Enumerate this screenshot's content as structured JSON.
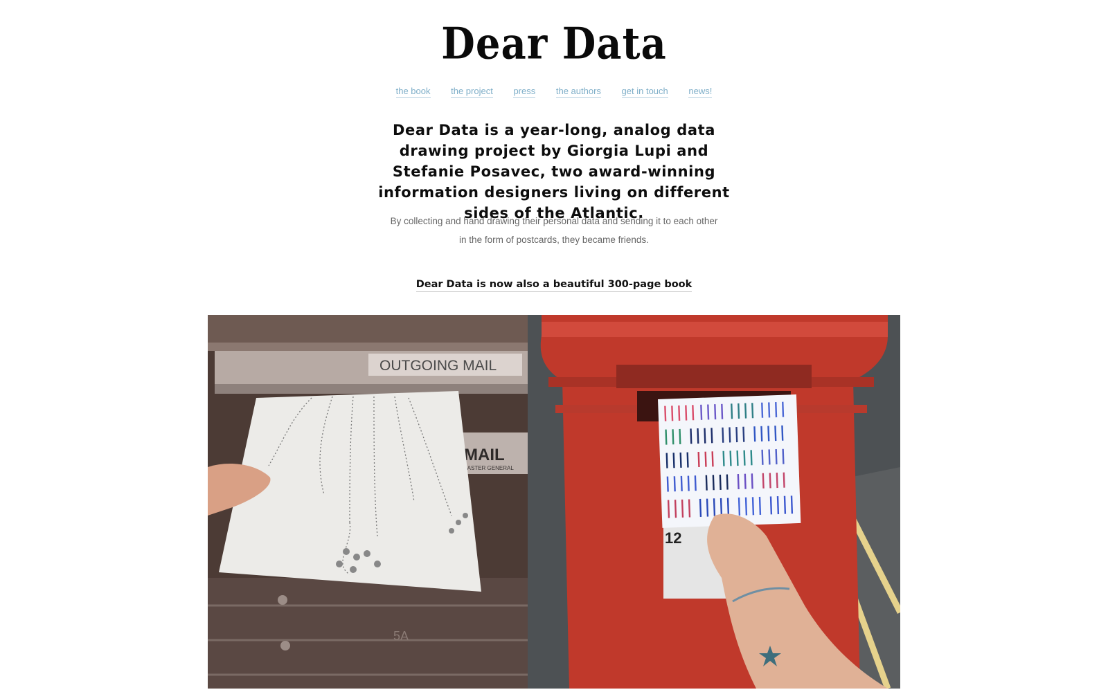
{
  "site": {
    "logo": "Dear Data"
  },
  "nav": {
    "items": [
      {
        "label": "the book"
      },
      {
        "label": "the project"
      },
      {
        "label": "press"
      },
      {
        "label": "the authors"
      },
      {
        "label": "get in touch"
      },
      {
        "label": "news!"
      }
    ]
  },
  "intro": {
    "headline": "Dear Data is a year-long, analog data drawing project by Giorgia Lupi and Stefanie Posavec, two award-winning information designers living on different sides of the Atlantic.",
    "subtext": "By collecting and hand drawing their personal data and sending it to each other in the form of postcards, they became friends."
  },
  "book": {
    "link_label": "Dear Data is now also a beautiful 300-page book"
  },
  "photos": {
    "left_sign": "OUTGOING MAIL",
    "left_mailbox_label": "MAIL",
    "left_mailbox_sub": "MASTER GENERAL",
    "left_box_number": "5A",
    "right_box_number": "12"
  },
  "colors": {
    "nav_link": "#7eaec8",
    "postbox_red": "#c0392b"
  }
}
